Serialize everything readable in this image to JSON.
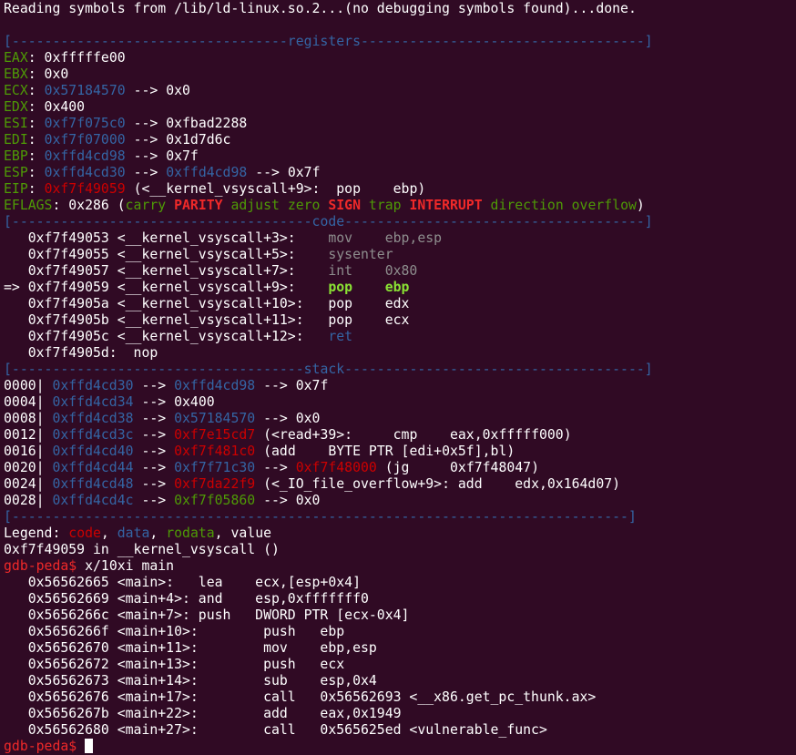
{
  "window": {
    "background": "#300a24"
  },
  "colors": {
    "default": "#ffffff",
    "separator": "#3465a4",
    "register_name": "#4e9a06",
    "value_data": "#3465a4",
    "value_code": "#cc0000",
    "value_rodata": "#4e9a06",
    "flag_set": "#ef2929",
    "flag_clear": "#4e9a06",
    "current_instruction": "#8ae234",
    "dim_instruction": "#8e8e8e",
    "prompt": "#ef2929",
    "cursor": "#ffffff"
  },
  "terminal": {
    "prompt_text": "gdb-peda$",
    "command": "x/10xi main",
    "lines": [
      [
        [
          "Reading symbols from /lib/ld-linux.so.2...(no debugging symbols found)...done.",
          "default"
        ]
      ],
      [],
      [
        [
          "[----------------------------------",
          "separator"
        ],
        [
          "registers",
          "separator"
        ],
        [
          "-----------------------------------]",
          "separator"
        ]
      ],
      [
        [
          "EAX",
          "register_name"
        ],
        [
          ": 0xfffffe00",
          "default"
        ]
      ],
      [
        [
          "EBX",
          "register_name"
        ],
        [
          ": 0x0",
          "default"
        ]
      ],
      [
        [
          "ECX",
          "register_name"
        ],
        [
          ": ",
          "default"
        ],
        [
          "0x57184570",
          "value_data"
        ],
        [
          " --> 0x0",
          "default"
        ]
      ],
      [
        [
          "EDX",
          "register_name"
        ],
        [
          ": 0x400",
          "default"
        ]
      ],
      [
        [
          "ESI",
          "register_name"
        ],
        [
          ": ",
          "default"
        ],
        [
          "0xf7f075c0",
          "value_data"
        ],
        [
          " --> 0xfbad2288",
          "default"
        ]
      ],
      [
        [
          "EDI",
          "register_name"
        ],
        [
          ": ",
          "default"
        ],
        [
          "0xf7f07000",
          "value_data"
        ],
        [
          " --> 0x1d7d6c",
          "default"
        ]
      ],
      [
        [
          "EBP",
          "register_name"
        ],
        [
          ": ",
          "default"
        ],
        [
          "0xffd4cd98",
          "value_data"
        ],
        [
          " --> 0x7f",
          "default"
        ]
      ],
      [
        [
          "ESP",
          "register_name"
        ],
        [
          ": ",
          "default"
        ],
        [
          "0xffd4cd30",
          "value_data"
        ],
        [
          " --> ",
          "default"
        ],
        [
          "0xffd4cd98",
          "value_data"
        ],
        [
          " --> 0x7f",
          "default"
        ]
      ],
      [
        [
          "EIP",
          "register_name"
        ],
        [
          ": ",
          "default"
        ],
        [
          "0xf7f49059",
          "value_code"
        ],
        [
          " (<__kernel_vsyscall+9>:  pop    ebp)",
          "default"
        ]
      ],
      [
        [
          "EFLAGS",
          "register_name"
        ],
        [
          ": 0x286 (",
          "default"
        ],
        [
          "carry ",
          "flag_clear"
        ],
        [
          "PARITY",
          "flag_set"
        ],
        [
          " adjust zero ",
          "flag_clear"
        ],
        [
          "SIGN",
          "flag_set"
        ],
        [
          " trap ",
          "flag_clear"
        ],
        [
          "INTERRUPT",
          "flag_set"
        ],
        [
          " direction overflow",
          "flag_clear"
        ],
        [
          ")",
          "default"
        ]
      ],
      [
        [
          "[-------------------------------------",
          "separator"
        ],
        [
          "code",
          "separator"
        ],
        [
          "-------------------------------------]",
          "separator"
        ]
      ],
      [
        [
          "   0xf7f49053 <__kernel_vsyscall+3>:    ",
          "default"
        ],
        [
          "mov    ebp,esp",
          "dim_instruction"
        ]
      ],
      [
        [
          "   0xf7f49055 <__kernel_vsyscall+5>:    ",
          "default"
        ],
        [
          "sysenter",
          "dim_instruction"
        ]
      ],
      [
        [
          "   0xf7f49057 <__kernel_vsyscall+7>:    ",
          "default"
        ],
        [
          "int    0x80",
          "dim_instruction"
        ]
      ],
      [
        [
          "=> 0xf7f49059 <__kernel_vsyscall+9>:    ",
          "default"
        ],
        [
          "pop    ebp",
          "current_instruction"
        ]
      ],
      [
        [
          "   0xf7f4905a <__kernel_vsyscall+10>:   pop    edx",
          "default"
        ]
      ],
      [
        [
          "   0xf7f4905b <__kernel_vsyscall+11>:   pop    ecx",
          "default"
        ]
      ],
      [
        [
          "   0xf7f4905c <__kernel_vsyscall+12>:   ",
          "default"
        ],
        [
          "ret",
          "value_data"
        ]
      ],
      [
        [
          "   0xf7f4905d:  nop",
          "default"
        ]
      ],
      [
        [
          "[------------------------------------",
          "separator"
        ],
        [
          "stack",
          "separator"
        ],
        [
          "-------------------------------------]",
          "separator"
        ]
      ],
      [
        [
          "0000| ",
          "default"
        ],
        [
          "0xffd4cd30",
          "value_data"
        ],
        [
          " --> ",
          "default"
        ],
        [
          "0xffd4cd98",
          "value_data"
        ],
        [
          " --> 0x7f",
          "default"
        ]
      ],
      [
        [
          "0004| ",
          "default"
        ],
        [
          "0xffd4cd34",
          "value_data"
        ],
        [
          " --> 0x400",
          "default"
        ]
      ],
      [
        [
          "0008| ",
          "default"
        ],
        [
          "0xffd4cd38",
          "value_data"
        ],
        [
          " --> ",
          "default"
        ],
        [
          "0x57184570",
          "value_data"
        ],
        [
          " --> 0x0",
          "default"
        ]
      ],
      [
        [
          "0012| ",
          "default"
        ],
        [
          "0xffd4cd3c",
          "value_data"
        ],
        [
          " --> ",
          "default"
        ],
        [
          "0xf7e15cd7",
          "value_code"
        ],
        [
          " (<read+39>:     cmp    eax,0xfffff000)",
          "default"
        ]
      ],
      [
        [
          "0016| ",
          "default"
        ],
        [
          "0xffd4cd40",
          "value_data"
        ],
        [
          " --> ",
          "default"
        ],
        [
          "0xf7f481c0",
          "value_code"
        ],
        [
          " (add    BYTE PTR [edi+0x5f],bl)",
          "default"
        ]
      ],
      [
        [
          "0020| ",
          "default"
        ],
        [
          "0xffd4cd44",
          "value_data"
        ],
        [
          " --> ",
          "default"
        ],
        [
          "0xf7f71c30",
          "value_data"
        ],
        [
          " --> ",
          "default"
        ],
        [
          "0xf7f48000",
          "value_code"
        ],
        [
          " (jg     0xf7f48047)",
          "default"
        ]
      ],
      [
        [
          "0024| ",
          "default"
        ],
        [
          "0xffd4cd48",
          "value_data"
        ],
        [
          " --> ",
          "default"
        ],
        [
          "0xf7da22f9",
          "value_code"
        ],
        [
          " (<_IO_file_overflow+9>: add    edx,0x164d07)",
          "default"
        ]
      ],
      [
        [
          "0028| ",
          "default"
        ],
        [
          "0xffd4cd4c",
          "value_data"
        ],
        [
          " --> ",
          "default"
        ],
        [
          "0xf7f05860",
          "value_rodata"
        ],
        [
          " --> 0x0",
          "default"
        ]
      ],
      [
        [
          "[----------------------------------------------------------------------------]",
          "separator"
        ]
      ],
      [
        [
          "Legend: ",
          "default"
        ],
        [
          "code",
          "value_code"
        ],
        [
          ", ",
          "default"
        ],
        [
          "data",
          "value_data"
        ],
        [
          ", ",
          "default"
        ],
        [
          "rodata",
          "value_rodata"
        ],
        [
          ", value",
          "default"
        ]
      ],
      [
        [
          "0xf7f49059 in __kernel_vsyscall ()",
          "default"
        ]
      ],
      [
        [
          "gdb-peda$",
          "prompt"
        ],
        [
          " x/10xi main",
          "default"
        ]
      ],
      [
        [
          "   0x56562665 <main>:   lea    ecx,[esp+0x4]",
          "default"
        ]
      ],
      [
        [
          "   0x56562669 <main+4>: and    esp,0xfffffff0",
          "default"
        ]
      ],
      [
        [
          "   0x5656266c <main+7>: push   DWORD PTR [ecx-0x4]",
          "default"
        ]
      ],
      [
        [
          "   0x5656266f <main+10>:        push   ebp",
          "default"
        ]
      ],
      [
        [
          "   0x56562670 <main+11>:        mov    ebp,esp",
          "default"
        ]
      ],
      [
        [
          "   0x56562672 <main+13>:        push   ecx",
          "default"
        ]
      ],
      [
        [
          "   0x56562673 <main+14>:        sub    esp,0x4",
          "default"
        ]
      ],
      [
        [
          "   0x56562676 <main+17>:        call   0x56562693 <__x86.get_pc_thunk.ax>",
          "default"
        ]
      ],
      [
        [
          "   0x5656267b <main+22>:        add    eax,0x1949",
          "default"
        ]
      ],
      [
        [
          "   0x56562680 <main+27>:        call   0x565625ed <vulnerable_func>",
          "default"
        ]
      ],
      [
        [
          "gdb-peda$",
          "prompt"
        ],
        [
          " ",
          "default"
        ]
      ]
    ]
  }
}
